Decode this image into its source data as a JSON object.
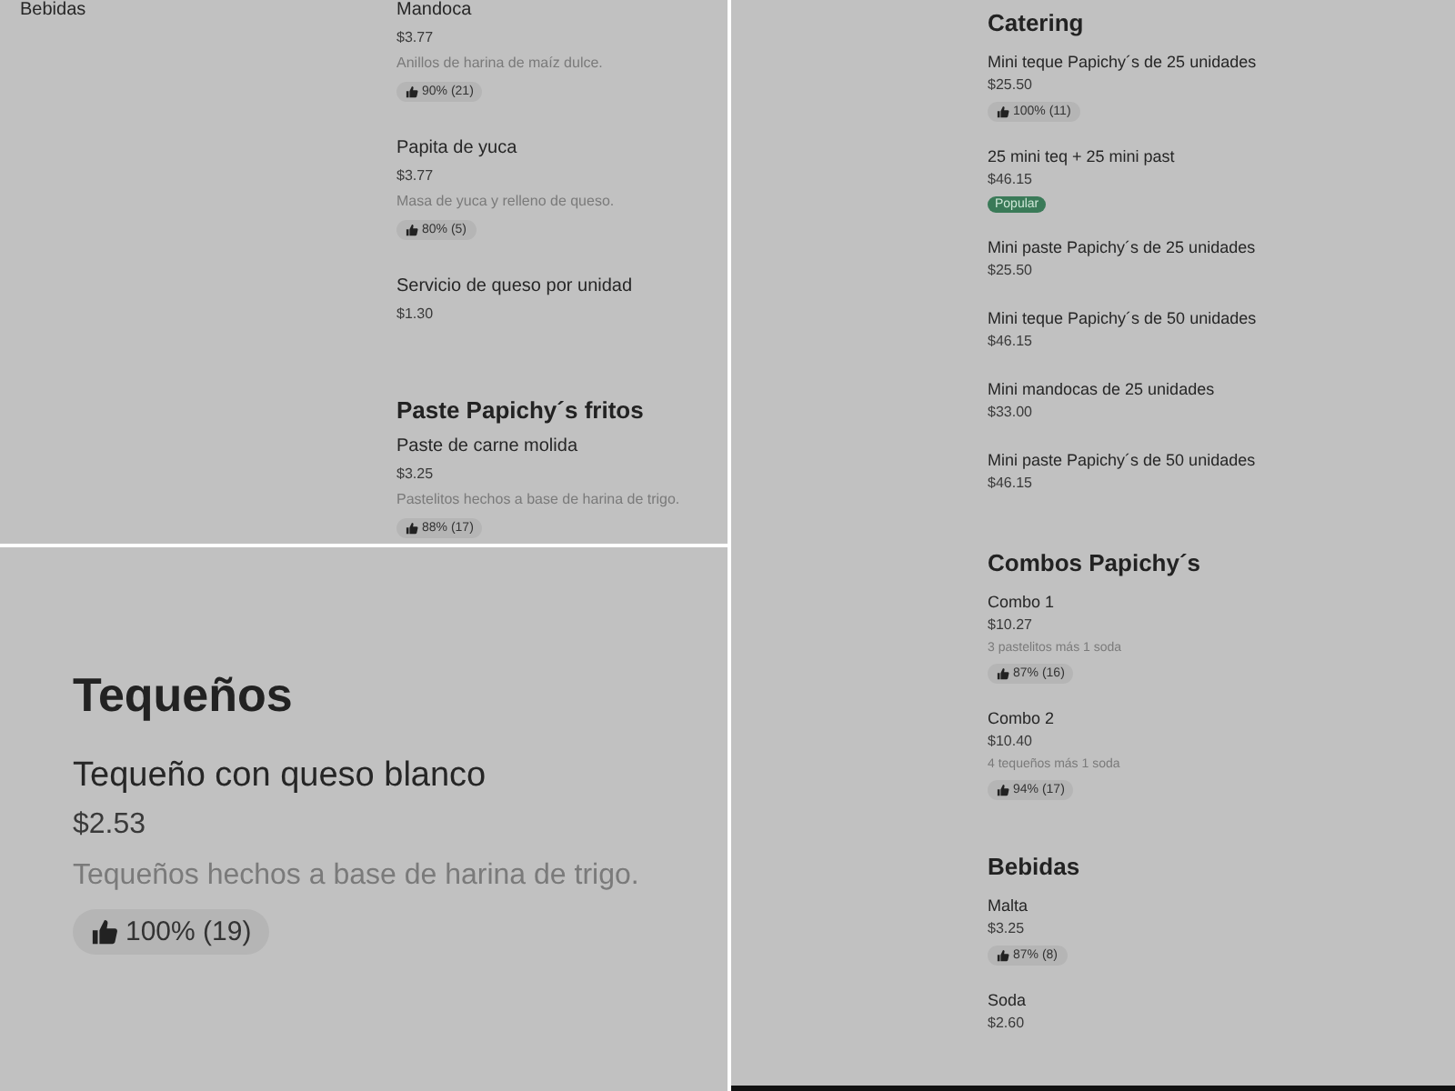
{
  "panels": [
    {
      "kind": "menu",
      "sidebar": {
        "items": [
          {
            "label": "Bebidas"
          }
        ]
      },
      "sections": [
        {
          "items": [
            {
              "name": "Mandoca",
              "price": "$3.77",
              "description": "Anillos de harina de maíz dulce.",
              "rating": "90% (21)"
            },
            {
              "name": "Papita de yuca",
              "price": "$3.77",
              "description": "Masa de yuca y relleno de queso.",
              "rating": "80% (5)"
            },
            {
              "name": "Servicio de queso por unidad",
              "price": "$1.30"
            }
          ]
        },
        {
          "title": "Paste Papichy´s fritos",
          "items": [
            {
              "name": "Paste de carne molida",
              "price": "$3.25",
              "description": "Pastelitos hechos a base de harina de trigo.",
              "rating": "88% (17)"
            }
          ]
        }
      ]
    },
    {
      "kind": "zoom",
      "sections": [
        {
          "title": "Tequeños",
          "items": [
            {
              "name": "Tequeño con queso blanco",
              "price": "$2.53",
              "description": "Tequeños hechos a base de harina de trigo.",
              "rating": "100% (19)"
            }
          ]
        }
      ]
    },
    {
      "kind": "list",
      "sections": [
        {
          "title": "Catering",
          "items": [
            {
              "name": "Mini teque Papichy´s de 25 unidades",
              "price": "$25.50",
              "rating": "100% (11)"
            },
            {
              "name": "25 mini teq + 25 mini past",
              "price": "$46.15",
              "badge": {
                "label": "Popular",
                "color": "#3a7a58"
              }
            },
            {
              "name": "Mini paste Papichy´s de 25 unidades",
              "price": "$25.50"
            },
            {
              "name": "Mini teque Papichy´s de 50 unidades",
              "price": "$46.15"
            },
            {
              "name": "Mini mandocas de 25 unidades",
              "price": "$33.00"
            },
            {
              "name": "Mini paste Papichy´s de 50 unidades",
              "price": "$46.15"
            }
          ]
        },
        {
          "title": "Combos Papichy´s",
          "items": [
            {
              "name": "Combo 1",
              "price": "$10.27",
              "description": "3 pastelitos más 1 soda",
              "rating": "87% (16)"
            },
            {
              "name": "Combo 2",
              "price": "$10.40",
              "description": "4 tequeños más 1 soda",
              "rating": "94% (17)"
            }
          ]
        },
        {
          "title": "Bebidas",
          "items": [
            {
              "name": "Malta",
              "price": "$3.25",
              "rating": "87% (8)"
            },
            {
              "name": "Soda",
              "price": "$2.60"
            }
          ]
        }
      ]
    }
  ]
}
